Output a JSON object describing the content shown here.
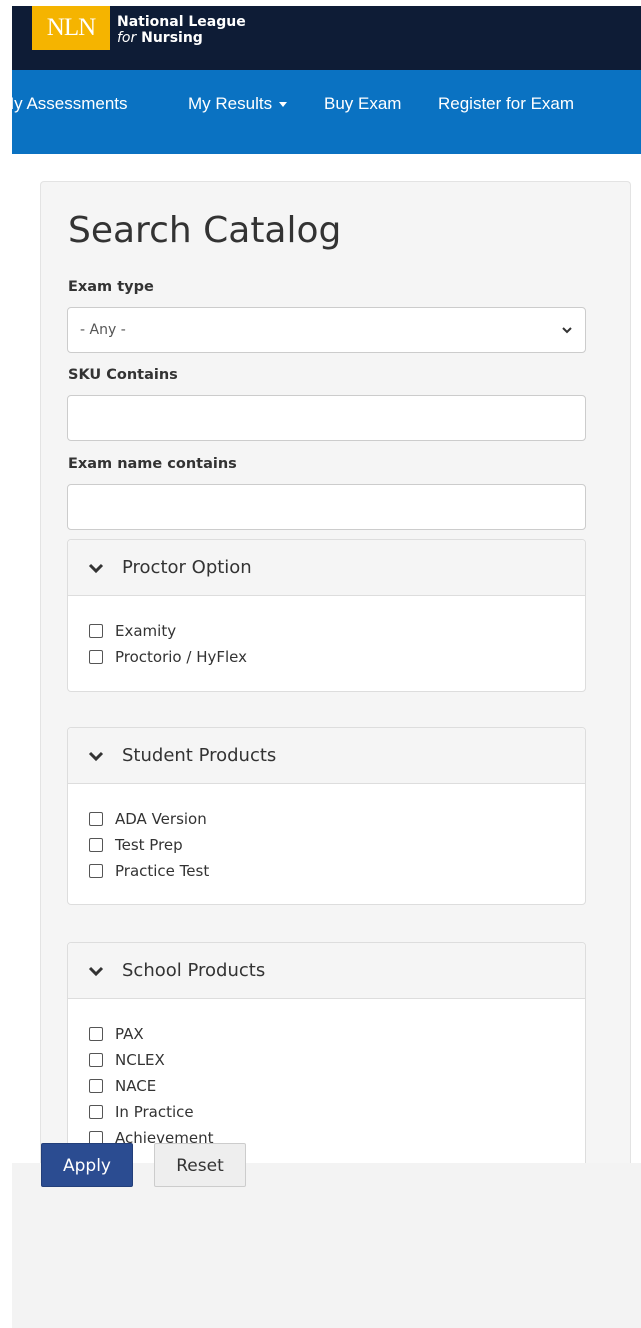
{
  "brand": {
    "logo_mark": "NLN",
    "name_line1": "National League",
    "name_for": "for",
    "name_line2": "Nursing",
    "logo_color": "#f5b400",
    "header_color": "#0e1c36"
  },
  "nav": {
    "color": "#0a72c2",
    "items": [
      {
        "label": "My Assessments"
      },
      {
        "label": "My Results",
        "dropdown": true
      },
      {
        "label": "Buy Exam"
      },
      {
        "label": "Register for Exam"
      }
    ]
  },
  "search": {
    "title": "Search Catalog",
    "exam_type_label": "Exam type",
    "exam_type_value": "- Any -",
    "sku_label": "SKU Contains",
    "sku_value": "",
    "exam_name_label": "Exam name contains",
    "exam_name_value": ""
  },
  "panels": {
    "proctor": {
      "title": "Proctor Option",
      "options": [
        "Examity",
        "Proctorio / HyFlex"
      ]
    },
    "student": {
      "title": "Student Products",
      "options": [
        "ADA Version",
        "Test Prep",
        "Practice Test"
      ]
    },
    "school": {
      "title": "School Products",
      "options": [
        "PAX",
        "NCLEX",
        "NACE",
        "In Practice",
        "Achievement"
      ]
    }
  },
  "actions": {
    "apply_label": "Apply",
    "reset_label": "Reset",
    "apply_color": "#2b4c91"
  }
}
